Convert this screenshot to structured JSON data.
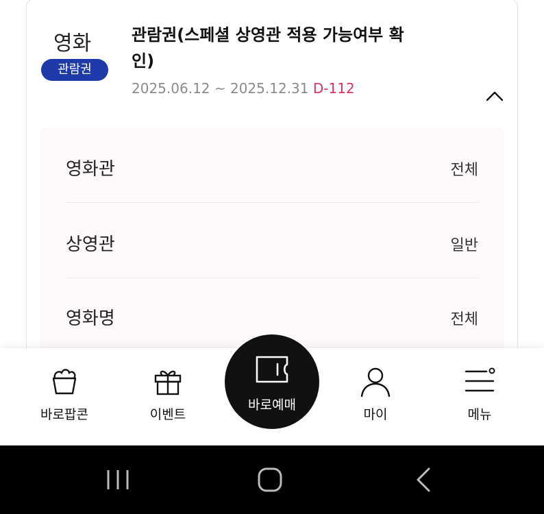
{
  "ticket": {
    "category": "영화",
    "badge": "관람권",
    "title": "관람권(스페셜 상영관 적용 가능여부 확인)",
    "period": "2025.06.12 ~ 2025.12.31",
    "dday": "D-112"
  },
  "details": [
    {
      "label": "영화관",
      "value": "전체"
    },
    {
      "label": "상영관",
      "value": "일반"
    },
    {
      "label": "영화명",
      "value": "전체"
    }
  ],
  "tabbar": {
    "popcorn": "바로팝콘",
    "event": "이벤트",
    "booking": "바로예매",
    "my": "마이",
    "menu": "메뉴"
  },
  "icons": {
    "collapse": "chevron-up-icon",
    "popcorn": "popcorn-icon",
    "event": "gift-icon",
    "booking": "ticket-icon",
    "my": "person-icon",
    "menu": "hamburger-icon"
  },
  "colors": {
    "badge": "#1e3aa8",
    "dday": "#d6335f",
    "booking_button": "#111111",
    "detail_background": "#fdf9fb"
  }
}
